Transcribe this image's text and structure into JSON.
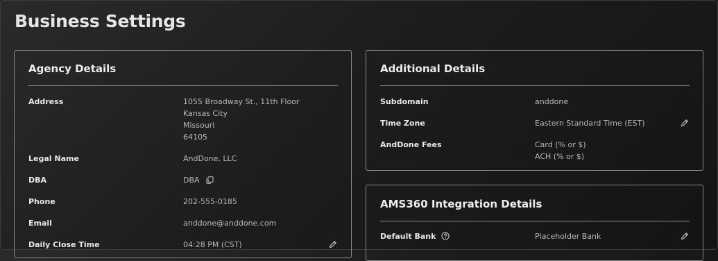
{
  "page": {
    "title": "Business Settings"
  },
  "agency_details": {
    "title": "Agency Details",
    "address": {
      "label": "Address",
      "line1": "1055 Broadway St., 11th Floor",
      "line2": "Kansas City",
      "line3": "Missouri",
      "line4": "64105"
    },
    "legal_name": {
      "label": "Legal Name",
      "value": "AndDone, LLC"
    },
    "dba": {
      "label": "DBA",
      "value": "DBA"
    },
    "phone": {
      "label": "Phone",
      "value": "202-555-0185"
    },
    "email": {
      "label": "Email",
      "value": "anddone@anddone.com"
    },
    "daily_close_time": {
      "label": "Daily Close Time",
      "value": "04:28 PM (CST)"
    }
  },
  "additional_details": {
    "title": "Additional Details",
    "subdomain": {
      "label": "Subdomain",
      "value": "anddone"
    },
    "time_zone": {
      "label": "Time Zone",
      "value": "Eastern Standard Time (EST)"
    },
    "anddone_fees": {
      "label": "AndDone Fees",
      "value1": "Card (% or $)",
      "value2": "ACH (% or $)"
    }
  },
  "ams360": {
    "title": "AMS360 Integration Details",
    "default_bank": {
      "label": "Default Bank",
      "value": "Placeholder Bank"
    }
  },
  "icons": {
    "edit": "pencil-icon",
    "copy": "copy-icon",
    "help": "help-circle-icon"
  },
  "colors": {
    "background": "#1d1d1d",
    "card_border": "#8a8a8a",
    "label": "#e8e8e8",
    "value": "#b9b9b9"
  }
}
